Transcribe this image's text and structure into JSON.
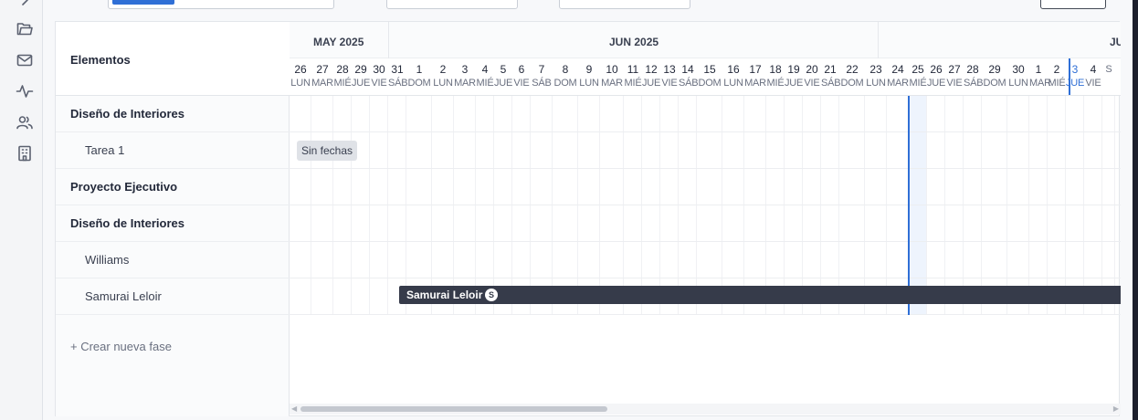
{
  "sidebar": {
    "icons": [
      "chevron-right-icon",
      "folder-icon",
      "mail-icon",
      "activity-icon",
      "users-icon",
      "building-icon"
    ]
  },
  "left_panel": {
    "header": "Elementos",
    "rows": [
      {
        "label": "Diseño de Interiores",
        "kind": "phase"
      },
      {
        "label": "Tarea 1",
        "kind": "task"
      },
      {
        "label": "Proyecto Ejecutivo",
        "kind": "phase"
      },
      {
        "label": "Diseño de Interiores",
        "kind": "phase"
      },
      {
        "label": "Williams",
        "kind": "task"
      },
      {
        "label": "Samurai Leloir",
        "kind": "task"
      }
    ],
    "new_phase": "+ Crear nueva fase"
  },
  "timeline": {
    "months": [
      {
        "label": "MAY 2025"
      },
      {
        "label": "JUN 2025"
      },
      {
        "label": "JU"
      }
    ],
    "days": [
      {
        "num": "26",
        "wd": "LUN"
      },
      {
        "num": "27",
        "wd": "MAR"
      },
      {
        "num": "28",
        "wd": "MIÉ"
      },
      {
        "num": "29",
        "wd": "JUE"
      },
      {
        "num": "30",
        "wd": "VIE"
      },
      {
        "num": "31",
        "wd": "SÁB"
      },
      {
        "num": "1",
        "wd": "DOM"
      },
      {
        "num": "2",
        "wd": "LUN"
      },
      {
        "num": "3",
        "wd": "MAR"
      },
      {
        "num": "4",
        "wd": "MIÉ"
      },
      {
        "num": "5",
        "wd": "JUE"
      },
      {
        "num": "6",
        "wd": "VIE"
      },
      {
        "num": "7",
        "wd": "SÁB"
      },
      {
        "num": "8",
        "wd": "DOM"
      },
      {
        "num": "9",
        "wd": "LUN"
      },
      {
        "num": "10",
        "wd": "MAR"
      },
      {
        "num": "11",
        "wd": "MIÉ"
      },
      {
        "num": "12",
        "wd": "JUE"
      },
      {
        "num": "13",
        "wd": "VIE"
      },
      {
        "num": "14",
        "wd": "SÁB"
      },
      {
        "num": "15",
        "wd": "DOM"
      },
      {
        "num": "16",
        "wd": "LUN"
      },
      {
        "num": "17",
        "wd": "MAR"
      },
      {
        "num": "18",
        "wd": "MIÉ"
      },
      {
        "num": "19",
        "wd": "JUE"
      },
      {
        "num": "20",
        "wd": "VIE"
      },
      {
        "num": "21",
        "wd": "SÁB"
      },
      {
        "num": "22",
        "wd": "DOM"
      },
      {
        "num": "23",
        "wd": "LUN"
      },
      {
        "num": "24",
        "wd": "MAR"
      },
      {
        "num": "25",
        "wd": "MIÉ"
      },
      {
        "num": "26",
        "wd": "JUE"
      },
      {
        "num": "27",
        "wd": "VIE"
      },
      {
        "num": "28",
        "wd": "SÁB"
      },
      {
        "num": "29",
        "wd": "DOM"
      },
      {
        "num": "30",
        "wd": "LUN"
      },
      {
        "num": "1",
        "wd": "MAR"
      },
      {
        "num": "2",
        "wd": "MIÉ"
      },
      {
        "num": "3",
        "wd": "JUE"
      },
      {
        "num": "4",
        "wd": "VIE"
      },
      {
        "num": "",
        "wd": "S"
      }
    ],
    "today_marker_day": "25",
    "selected_marker_day": "3"
  },
  "items": {
    "sin_fechas": "Sin fechas",
    "bar_label": "Samurai Leloir",
    "bar_badge": "S",
    "bar_color": "#363b4a"
  },
  "colors": {
    "accent": "#2f6fd6",
    "today_band": "#eef4fd"
  }
}
